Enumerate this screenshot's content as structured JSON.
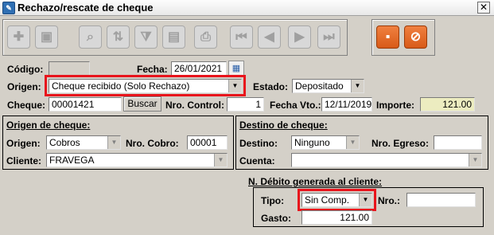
{
  "window": {
    "title": "Rechazo/rescate de cheque",
    "close_glyph": "✕"
  },
  "toolbar": {
    "buttons": [
      {
        "name": "add-icon",
        "glyph": "✚"
      },
      {
        "name": "delete-icon",
        "glyph": "▣"
      },
      {
        "name": "search-icon",
        "glyph": "⌕"
      },
      {
        "name": "sort-icon",
        "glyph": "⇅"
      },
      {
        "name": "filter-icon",
        "glyph": "⧩"
      },
      {
        "name": "clipboard-icon",
        "glyph": "▤"
      },
      {
        "name": "print-icon",
        "glyph": "⎙"
      },
      {
        "name": "first-icon",
        "glyph": "⏮"
      },
      {
        "name": "prev-icon",
        "glyph": "◀"
      },
      {
        "name": "next-icon",
        "glyph": "▶"
      },
      {
        "name": "last-icon",
        "glyph": "⏭"
      }
    ],
    "save_glyph": "▪",
    "cancel_glyph": "⊘"
  },
  "form": {
    "codigo_label": "Código:",
    "codigo_value": "",
    "fecha_label": "Fecha:",
    "fecha_value": "26/01/2021",
    "calendar_glyph": "▦",
    "origen_label": "Origen:",
    "origen_value": "Cheque recibido (Solo Rechazo)",
    "estado_label": "Estado:",
    "estado_value": "Depositado",
    "cheque_label": "Cheque:",
    "cheque_value": "00001421",
    "buscar_label": "Buscar",
    "nro_control_label": "Nro. Control:",
    "nro_control_value": "1",
    "fecha_vto_label": "Fecha Vto.:",
    "fecha_vto_value": "12/11/2019",
    "importe_label": "Importe:",
    "importe_value": "121.00"
  },
  "origen_cheque": {
    "title": "Origen de cheque:",
    "origen_label": "Origen:",
    "origen_value": "Cobros",
    "nro_cobro_label": "Nro. Cobro:",
    "nro_cobro_value": "00001",
    "cliente_label": "Cliente:",
    "cliente_value": "FRAVEGA"
  },
  "destino_cheque": {
    "title": "Destino de cheque:",
    "destino_label": "Destino:",
    "destino_value": "Ninguno",
    "nro_egreso_label": "Nro. Egreso:",
    "nro_egreso_value": "",
    "cuenta_label": "Cuenta:",
    "cuenta_value": ""
  },
  "nd_cliente": {
    "title": "N. Débito generada al cliente:",
    "tipo_label": "Tipo:",
    "tipo_value": "Sin Comp.",
    "nro_label": "Nro.:",
    "nro_value": "",
    "gasto_label": "Gasto:",
    "gasto_value": "121.00"
  },
  "colors": {
    "highlight": "#e8141c",
    "accent_orange": "#e06a28"
  },
  "dropdown_arrow": "▼"
}
